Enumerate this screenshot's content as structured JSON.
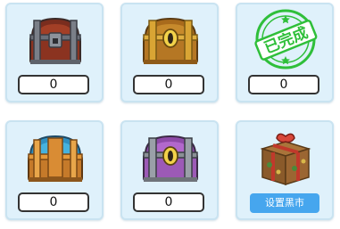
{
  "chests": [
    {
      "count": "0",
      "icon": "red-treasure-chest-icon"
    },
    {
      "count": "0",
      "icon": "gold-treasure-chest-icon"
    },
    {
      "count": "0",
      "icon": "completed-stamp-icon",
      "stamp_text": "已完成"
    },
    {
      "count": "0",
      "icon": "blue-treasure-chest-icon"
    },
    {
      "count": "0",
      "icon": "purple-treasure-chest-icon"
    }
  ],
  "black_market": {
    "icon": "black-market-gift-box-icon",
    "button_label": "设置黑市"
  },
  "colors": {
    "card_bg": "#dff1fb",
    "card_border": "#c9e3f1",
    "stamp_green": "#2fbf3a",
    "button_blue": "#46a6ee"
  }
}
